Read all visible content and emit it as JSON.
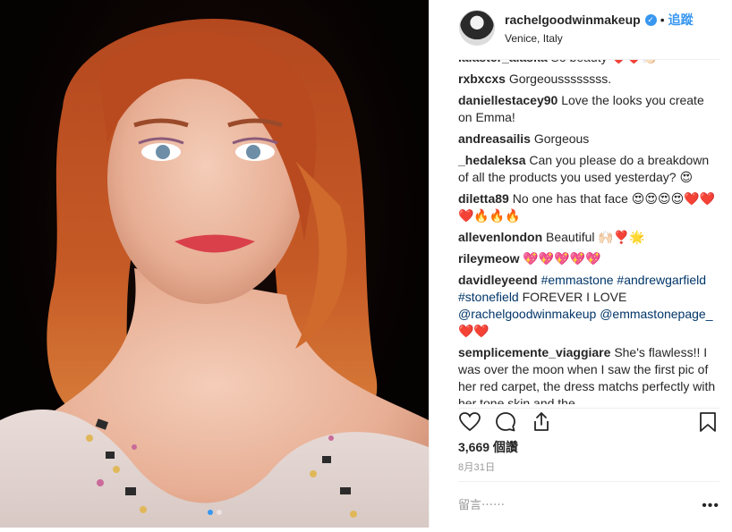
{
  "post": {
    "image_alt_icon": "portrait-photo",
    "carousel_count": 2,
    "carousel_active": 1
  },
  "header": {
    "username": "rachelgoodwinmakeup",
    "verified_icon": "verified-badge-icon",
    "separator": "•",
    "follow_label": "追蹤",
    "location": "Venice, Italy"
  },
  "comments": [
    {
      "user": "lalaster_alaska",
      "text": "So beauty ❤️❤️👏🏻"
    },
    {
      "user": "rxbxcxs",
      "text": "Gorgeoussssssss."
    },
    {
      "user": "daniellestacey90",
      "text": "Love the looks you create on Emma!"
    },
    {
      "user": "andreasailis",
      "text": "Gorgeous"
    },
    {
      "user": "_hedaleksa",
      "text": "Can you please do a breakdown of all the products you used yesterday? 😍"
    },
    {
      "user": "diletta89",
      "text": "No one has that face 😍😍😍😍❤️❤️❤️🔥🔥🔥"
    },
    {
      "user": "allevenlondon",
      "text": "Beautiful 🙌🏻❣️🌟"
    },
    {
      "user": "rileymeow",
      "text": "💖💖💖💖💖"
    },
    {
      "user": "davidleyeend",
      "text_parts": [
        {
          "t": "#emmastone",
          "tag": true
        },
        {
          "t": " ",
          "tag": false
        },
        {
          "t": "#andrewgarfield",
          "tag": true
        },
        {
          "t": " ",
          "tag": false
        },
        {
          "t": "#stonefield",
          "tag": true
        },
        {
          "t": " FOREVER I LOVE ",
          "tag": false
        },
        {
          "t": "@rachelgoodwinmakeup",
          "tag": true
        },
        {
          "t": " ",
          "tag": false
        },
        {
          "t": "@emmastonepage_",
          "tag": true
        },
        {
          "t": " ❤️❤️",
          "tag": false
        }
      ]
    },
    {
      "user": "semplicemente_viaggiare",
      "text": "She's flawless!! I was over the moon when I saw the first pic of her red carpet, the dress matchs perfectly with her tone skin and the"
    }
  ],
  "actions": {
    "like_icon": "heart-icon",
    "comment_icon": "comment-icon",
    "share_icon": "share-icon",
    "save_icon": "bookmark-icon"
  },
  "likes": "3,669 個讚",
  "date": "8月31日",
  "add_comment": {
    "placeholder": "留言⋯⋯",
    "more_icon": "more-options-icon",
    "more_glyph": "•••"
  },
  "colors": {
    "accent": "#3897f0",
    "hashtag": "#003569",
    "muted": "#999999",
    "text": "#262626"
  }
}
